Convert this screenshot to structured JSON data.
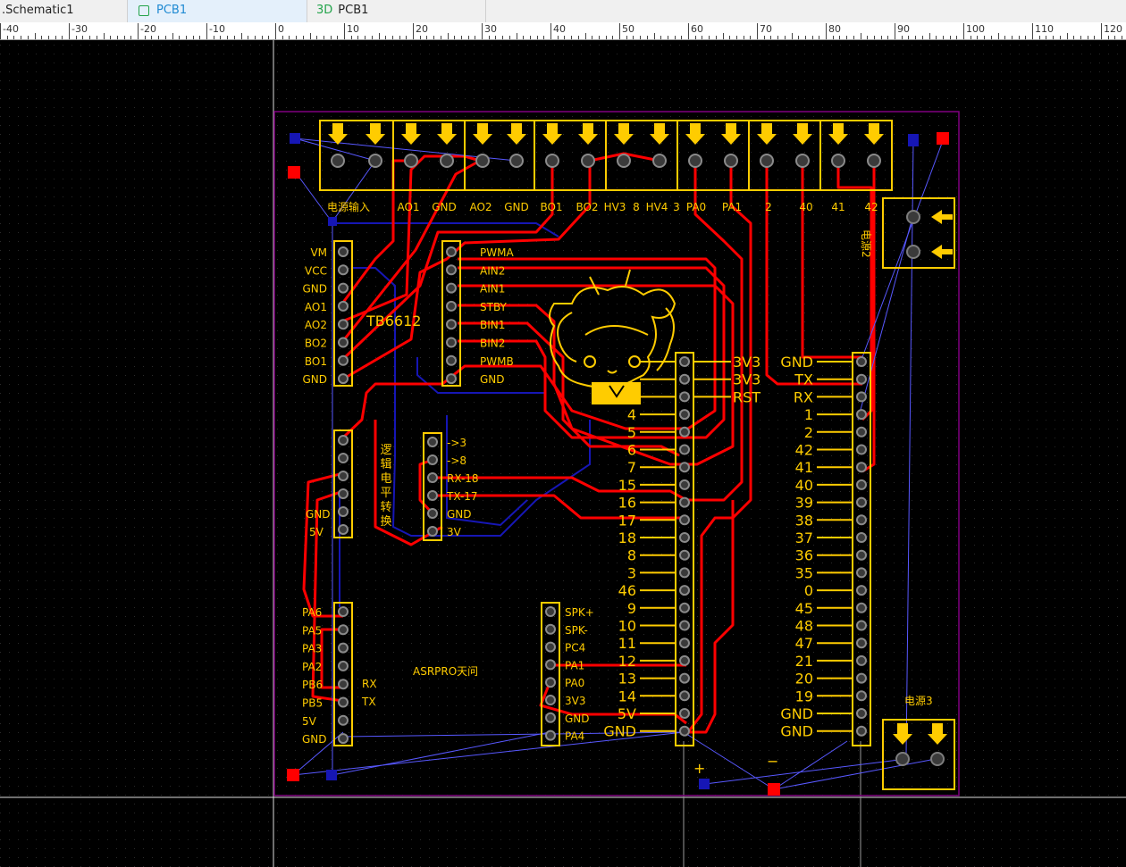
{
  "tabs": [
    {
      "label": ".Schematic1",
      "icon": "schematic-icon"
    },
    {
      "label": "PCB1",
      "icon": "pcb-icon"
    },
    {
      "label": "PCB1",
      "icon": "3d-icon",
      "prefix": "3D"
    }
  ],
  "ruler": {
    "labels": [
      "-40",
      "-30",
      "-20",
      "-10",
      "0",
      "10",
      "20",
      "30",
      "40",
      "50",
      "60",
      "70",
      "80",
      "90",
      "100",
      "110",
      "120"
    ]
  },
  "top_connector_labels": [
    "电源输入",
    "AO1",
    "GND",
    "AO2",
    "GND",
    "BO1",
    "BO2",
    "HV3",
    "8",
    "HV4",
    "3",
    "PA0",
    "PA1",
    "2",
    "40",
    "41",
    "42"
  ],
  "power2_label": "电源2",
  "power3_label": "电源3",
  "tb_pins": [
    "VM",
    "VCC",
    "GND",
    "AO1",
    "AO2",
    "BO2",
    "BO1",
    "GND"
  ],
  "tb_title": "TB6612",
  "tb_ctrl_pins": [
    "PWMA",
    "AIN2",
    "AIN1",
    "STBY",
    "BIN1",
    "BIN2",
    "PWMB",
    "GND"
  ],
  "pwr_pins": [
    "GND",
    "5V"
  ],
  "level_shift_label": "逻辑电平转换",
  "level_pins": [
    "->3",
    "->8",
    "RX-18",
    "TX-17",
    "GND",
    "3V"
  ],
  "left_header_pins": [
    "PA6",
    "PA5",
    "PA3",
    "PA2",
    "PB6",
    "PB5",
    "5V",
    "GND"
  ],
  "rx_label": "RX",
  "tx_label": "TX",
  "asr_label": "ASRPRO天问",
  "spk_pins": [
    "SPK+",
    "SPK-",
    "PC4",
    "PA1",
    "PA0",
    "3V3",
    "GND",
    "PA4"
  ],
  "esp_left_pins": [
    "3V3",
    "3V3",
    "RST",
    "4",
    "5",
    "6",
    "7",
    "15",
    "16",
    "17",
    "18",
    "8",
    "3",
    "46",
    "9",
    "10",
    "11",
    "12",
    "13",
    "14",
    "5V",
    "GND"
  ],
  "esp_right_pins": [
    "GND",
    "TX",
    "RX",
    "1",
    "2",
    "42",
    "41",
    "40",
    "39",
    "38",
    "37",
    "36",
    "35",
    "0",
    "45",
    "48",
    "47",
    "21",
    "20",
    "19",
    "GND",
    "GND"
  ],
  "plus_label": "+",
  "minus_label": "−",
  "colors": {
    "top": "#ff0000",
    "bottom": "#1616b5",
    "silk": "#ffcc00",
    "pad": "#7d7d7d",
    "outline": "#800080",
    "ratsnest": "#5858ff"
  }
}
